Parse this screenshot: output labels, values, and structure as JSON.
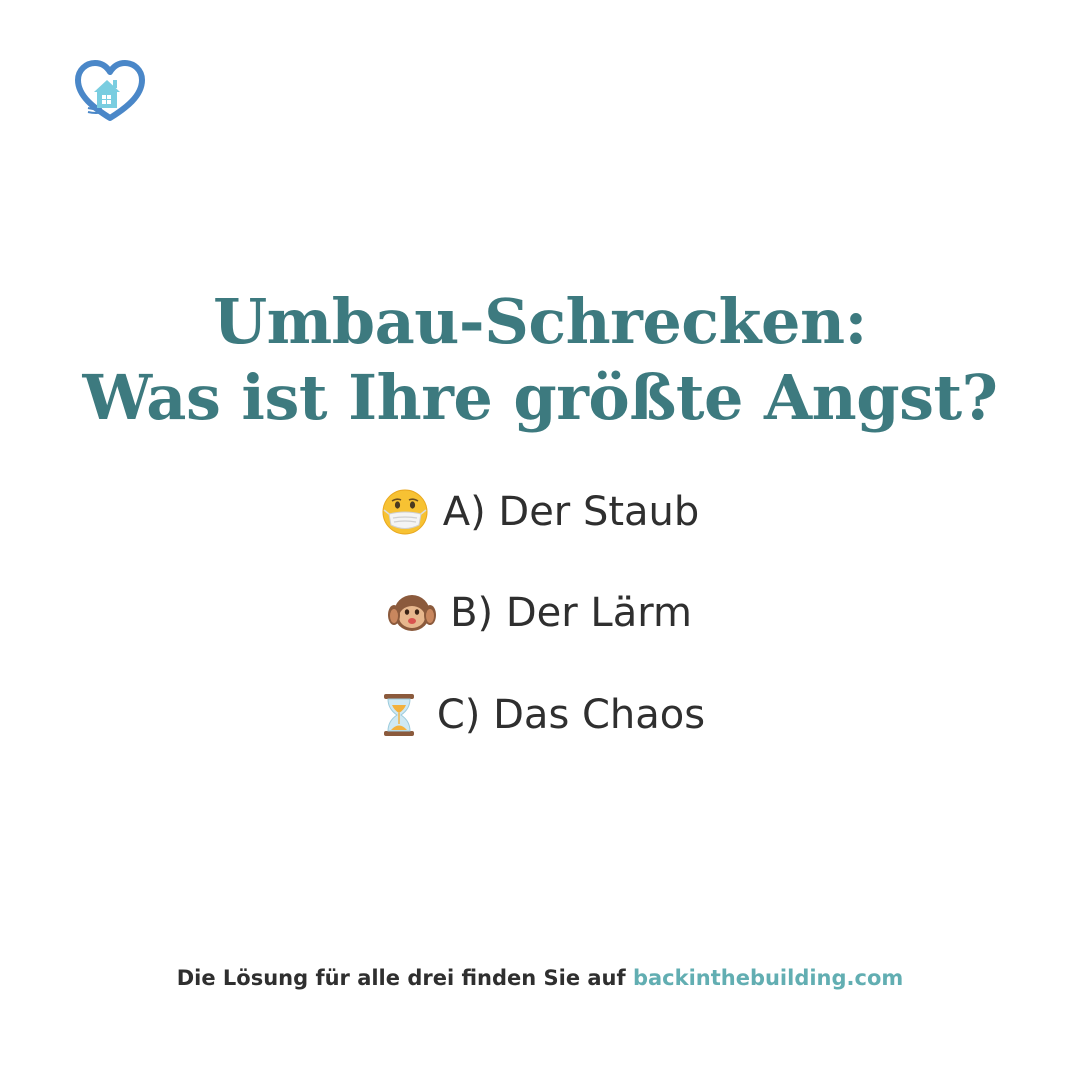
{
  "logo": {
    "icon": "heart-house-logo",
    "colors": {
      "heart": "#4a87c8",
      "house": "#79cde0"
    }
  },
  "title": {
    "line1": "Umbau-Schrecken:",
    "line2": "Was ist Ihre größte Angst?"
  },
  "options": [
    {
      "icon": "face-with-medical-mask-emoji",
      "label": "A) Der Staub"
    },
    {
      "icon": "hear-no-evil-monkey-emoji",
      "label": "B) Der Lärm"
    },
    {
      "icon": "hourglass-emoji",
      "label": "C) Das Chaos"
    }
  ],
  "footer": {
    "text": "Die Lösung für alle drei finden Sie auf",
    "link": "backinthebuilding.com"
  },
  "colors": {
    "title": "#3d7a7f",
    "body_text": "#2f2f2f",
    "link": "#62aeb2",
    "background": "#ffffff"
  }
}
